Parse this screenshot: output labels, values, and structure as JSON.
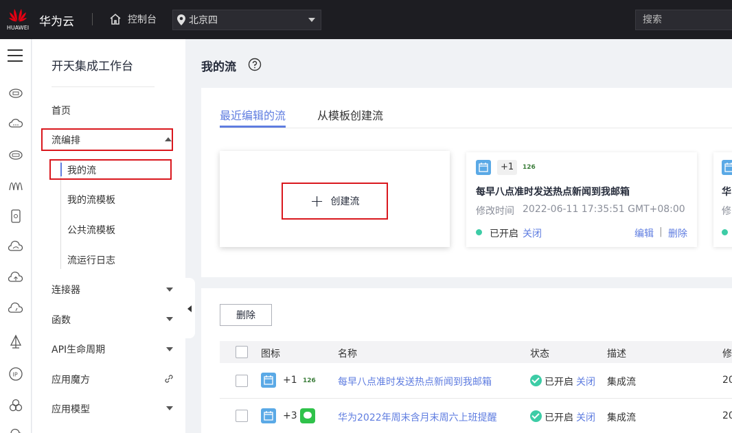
{
  "topbar": {
    "logo_text": "HUAWEI",
    "brand": "华为云",
    "console_label": "控制台",
    "region": "北京四",
    "search_placeholder": "搜索"
  },
  "nav": {
    "title": "开天集成工作台",
    "home": "首页",
    "flow_orchestration": "流编排",
    "sub_items": [
      "我的流",
      "我的流模板",
      "公共流模板",
      "流运行日志"
    ],
    "connector": "连接器",
    "functions": "函数",
    "api_lifecycle": "API生命周期",
    "app_magic": "应用魔方",
    "app_model": "应用模型"
  },
  "main": {
    "title": "我的流",
    "tabs": [
      "最近编辑的流",
      "从模板创建流"
    ],
    "create_label": "创建流",
    "card": {
      "badge_plus": "+1",
      "badge_mail": "126",
      "title": "每早八点准时发送热点新闻到我邮箱",
      "modified_label": "修改时间",
      "modified_value": "2022-06-11 17:35:51 GMT+08:00",
      "status": "已开启",
      "close": "关闭",
      "edit": "编辑",
      "sep": "|",
      "delete": "删除"
    },
    "card2": {
      "title_fragment": "华",
      "meta_fragment": "修"
    },
    "delete_button": "删除",
    "table": {
      "headers": [
        "图标",
        "名称",
        "状态",
        "描述",
        "修"
      ],
      "rows": [
        {
          "plus": "+1",
          "mail": "126",
          "name": "每早八点准时发送热点新闻到我邮箱",
          "status": "已开启",
          "action": "关闭",
          "desc": "集成流",
          "extra": "20"
        },
        {
          "plus": "+3",
          "name": "华为2022年周末含月末周六上班提醒",
          "status": "已开启",
          "action": "关闭",
          "desc": "集成流",
          "extra": "20"
        }
      ]
    }
  },
  "colors": {
    "accent": "#5e7ce0",
    "highlight_red": "#d9161c",
    "status_green": "#3dcca6",
    "topbar_bg": "#1d1d22"
  }
}
